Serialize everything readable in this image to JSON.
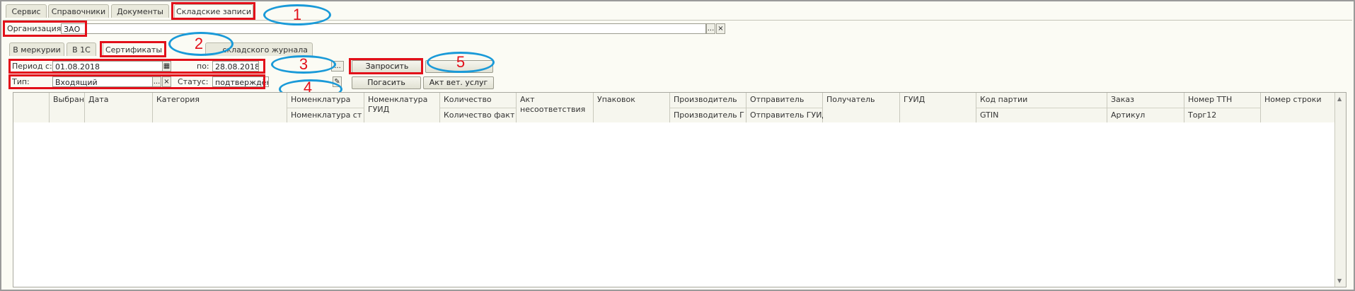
{
  "top_tabs": [
    "Сервис",
    "Справочники",
    "Документы",
    "Складские записи"
  ],
  "org": {
    "label": "Организация:",
    "value": "ЗАО",
    "select_btn": "...",
    "clear_btn": "×"
  },
  "sub_tabs": [
    "В меркурии",
    "В 1С",
    "Сертификаты",
    "складского журнала"
  ],
  "period": {
    "from_label": "Период с:",
    "from_value": "01.08.2018",
    "to_label": "по:",
    "to_value": "28.08.2018",
    "range_btn": "..."
  },
  "filter": {
    "type_label": "Тип:",
    "type_value": "Входящий",
    "type_select": "...",
    "type_clear": "×",
    "status_label": "Статус:",
    "status_value": "подтверждён"
  },
  "buttons": {
    "request": "Запросить",
    "extinguish": "Погасить",
    "act": "Акт вет. услуг"
  },
  "callouts": [
    "1",
    "2",
    "3",
    "4",
    "5"
  ],
  "columns": {
    "selected": "Выбран",
    "date": "Дата",
    "category": "Категория",
    "nomenclature": "Номенклатура",
    "nomenclature_st": "Номенклатура ст...",
    "nomenclature_guid": "Номенклатура ГУИД",
    "quantity": "Количество",
    "quantity_fact": "Количество факт",
    "act": "Акт несоответствия",
    "packaging": "Упаковок",
    "producer": "Производитель",
    "producer_g": "Производитель Г...",
    "sender": "Отправитель",
    "sender_guid": "Отправитель ГУИД",
    "recipient": "Получатель",
    "guid": "ГУИД",
    "batch_code": "Код партии",
    "gtin": "GTIN",
    "order": "Заказ",
    "article": "Артикул",
    "ttn": "Номер ТТН",
    "torg12": "Торг12",
    "row_number": "Номер строки"
  },
  "colors": {
    "highlight": "#e2101a",
    "callout": "#1a9ad8"
  }
}
